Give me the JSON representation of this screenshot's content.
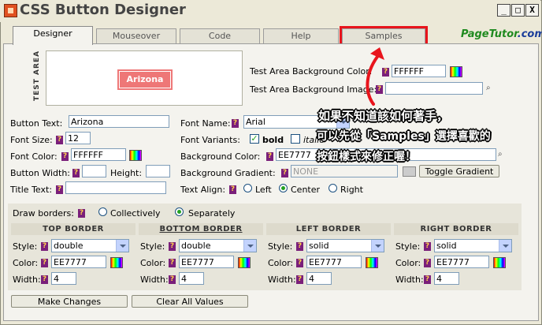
{
  "window": {
    "title": "CSS Button Designer",
    "min": "_",
    "max": "□",
    "close": "X"
  },
  "tabs": [
    {
      "label": "Designer"
    },
    {
      "label": "Mouseover"
    },
    {
      "label": "Code"
    },
    {
      "label": "Help"
    },
    {
      "label": "Samples"
    }
  ],
  "brand": {
    "main": "PageTutor",
    "suffix": ".com"
  },
  "test_area": {
    "label": "TEST AREA",
    "button_text": "Arizona",
    "bg_color_label": "Test Area Background Color:",
    "bg_color_value": "FFFFFF",
    "bg_image_label": "Test Area Background Image:",
    "bg_image_value": ""
  },
  "help_marker": "?",
  "left_fields": {
    "button_text_label": "Button Text:",
    "button_text_value": "Arizona",
    "font_size_label": "Font Size:",
    "font_size_value": "12",
    "font_color_label": "Font Color:",
    "font_color_value": "FFFFFF",
    "button_width_label": "Button Width:",
    "button_width_value": "",
    "height_label": "Height:",
    "height_value": "",
    "title_text_label": "Title Text:",
    "title_text_value": ""
  },
  "right_fields": {
    "font_name_label": "Font Name:",
    "font_name_value": "Arial",
    "font_variants_label": "Font Variants:",
    "bold_label": "bold",
    "italic_label": "italic",
    "bg_color_label": "Background Color:",
    "bg_color_value": "EE7777",
    "bg_gradient_label": "Background Gradient:",
    "bg_gradient_value": "NONE",
    "toggle_gradient": "Toggle Gradient",
    "text_align_label": "Text Align:",
    "align_left": "Left",
    "align_center": "Center",
    "align_right": "Right"
  },
  "borders": {
    "draw_label": "Draw borders:",
    "collectively": "Collectively",
    "separately": "Separately",
    "columns": [
      {
        "head": "TOP BORDER",
        "style": "double",
        "color": "EE7777",
        "width": "4"
      },
      {
        "head": "BOTTOM BORDER",
        "style": "double",
        "color": "EE7777",
        "width": "4"
      },
      {
        "head": "LEFT BORDER",
        "style": "solid",
        "color": "EE7777",
        "width": "4"
      },
      {
        "head": "RIGHT BORDER",
        "style": "solid",
        "color": "EE7777",
        "width": "4"
      }
    ],
    "style_label": "Style:",
    "color_label": "Color:",
    "width_label": "Width:"
  },
  "actions": {
    "make_changes": "Make Changes",
    "clear_all": "Clear All Values"
  },
  "annotation": {
    "line1": "如果不知道該如何著手，",
    "line2": "可以先從「Samples」選擇喜歡的",
    "line3": "按鈕樣式來修正喔！",
    "highlight_color": "#e8141c"
  },
  "colors": {
    "sample_button": "#ee7777",
    "brand_green": "#1f8a1f",
    "brand_blue": "#1a3d9a"
  }
}
